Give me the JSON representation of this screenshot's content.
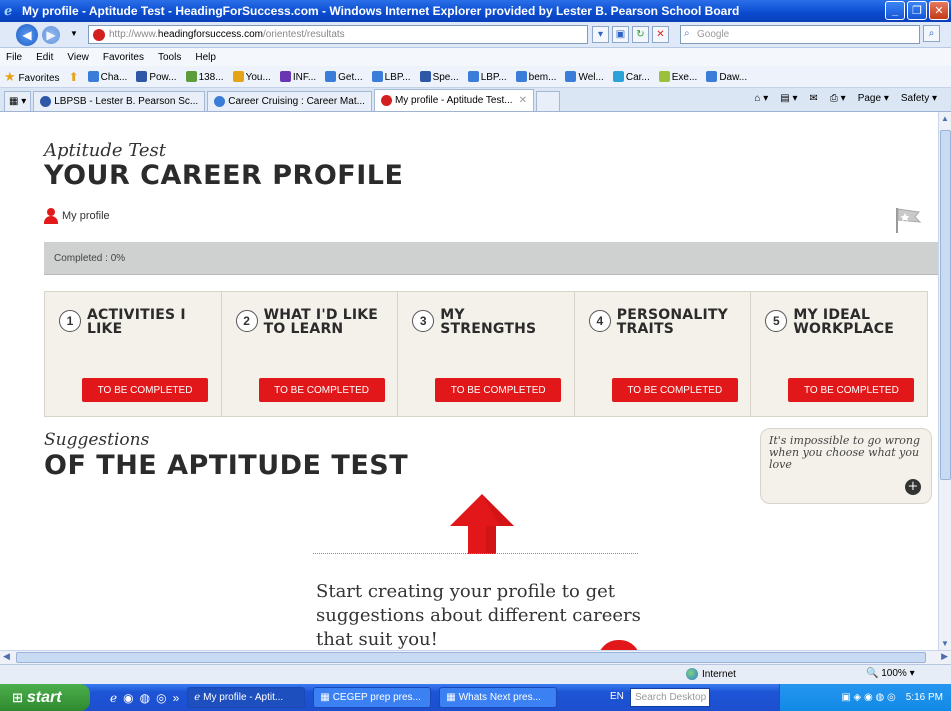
{
  "window": {
    "title": "My profile - Aptitude Test - HeadingForSuccess.com - Windows Internet Explorer provided by Lester B. Pearson School Board"
  },
  "address": {
    "url_prefix": "http://www.",
    "url_domain": "headingforsuccess.com",
    "url_path": "/orientest/resultats",
    "search_placeholder": "Google"
  },
  "menu": [
    "File",
    "Edit",
    "View",
    "Favorites",
    "Tools",
    "Help"
  ],
  "favorites_bar": {
    "label": "Favorites",
    "items": [
      {
        "label": "Cha...",
        "icon": "ie-icon",
        "color": "#3a7dd8"
      },
      {
        "label": "Pow...",
        "icon": "bell-icon",
        "color": "#2f57a8"
      },
      {
        "label": "138...",
        "icon": "photo-icon",
        "color": "#5c9c3a"
      },
      {
        "label": "You...",
        "icon": "folder-icon",
        "color": "#e7a316"
      },
      {
        "label": "INF...",
        "icon": "grid-icon",
        "color": "#6a35b2"
      },
      {
        "label": "Get...",
        "icon": "ie-icon",
        "color": "#3a7dd8"
      },
      {
        "label": "LBP...",
        "icon": "ie-icon",
        "color": "#3a7dd8"
      },
      {
        "label": "Spe...",
        "icon": "bell-icon",
        "color": "#2f57a8"
      },
      {
        "label": "LBP...",
        "icon": "ie-icon",
        "color": "#3a7dd8"
      },
      {
        "label": "bem...",
        "icon": "ie-icon",
        "color": "#3a7dd8"
      },
      {
        "label": "Wel...",
        "icon": "ie-icon",
        "color": "#3a7dd8"
      },
      {
        "label": "Car...",
        "icon": "globe-icon",
        "color": "#2ca3d8"
      },
      {
        "label": "Exe...",
        "icon": "leaf-icon",
        "color": "#9bc13a"
      },
      {
        "label": "Daw...",
        "icon": "ie-icon",
        "color": "#3a7dd8"
      }
    ]
  },
  "tabs": [
    {
      "label": "LBPSB - Lester B. Pearson Sc...",
      "active": false
    },
    {
      "label": "Career Cruising : Career Mat...",
      "active": false
    },
    {
      "label": "My profile - Aptitude Test...",
      "active": true
    }
  ],
  "tab_tools": {
    "page": "Page ▾",
    "safety": "Safety ▾"
  },
  "page": {
    "script_heading": "Aptitude Test",
    "main_heading": "YOUR CAREER PROFILE",
    "profile_link": "My profile",
    "progress_label": "Completed : 0%",
    "progress_value": 0,
    "steps": [
      {
        "num": "1",
        "label": "ACTIVITIES I LIKE",
        "button": "TO BE COMPLETED"
      },
      {
        "num": "2",
        "label": "WHAT I'D LIKE TO LEARN",
        "button": "TO BE COMPLETED"
      },
      {
        "num": "3",
        "label": "MY STRENGTHS",
        "button": "TO BE COMPLETED"
      },
      {
        "num": "4",
        "label": "PERSONALITY TRAITS",
        "button": "TO BE COMPLETED"
      },
      {
        "num": "5",
        "label": "MY IDEAL WORKPLACE",
        "button": "TO BE COMPLETED"
      }
    ],
    "suggestions_script": "Suggestions",
    "suggestions_heading": "OF THE APTITUDE TEST",
    "quote": "It's impossible to go wrong when you choose what you love",
    "start_text": "Start creating your profile to get suggestions about different careers that suit you!",
    "accent_color": "#e1171a"
  },
  "status": {
    "zone": "Internet",
    "zoom": "100%"
  },
  "taskbar": {
    "start": "start",
    "items": [
      {
        "label": "My profile - Aptit...",
        "active": true
      },
      {
        "label": "CEGEP prep pres...",
        "active": false
      },
      {
        "label": "Whats Next pres...",
        "active": false
      }
    ],
    "lang": "EN",
    "search_placeholder": "Search Desktop",
    "clock": "5:16 PM"
  }
}
